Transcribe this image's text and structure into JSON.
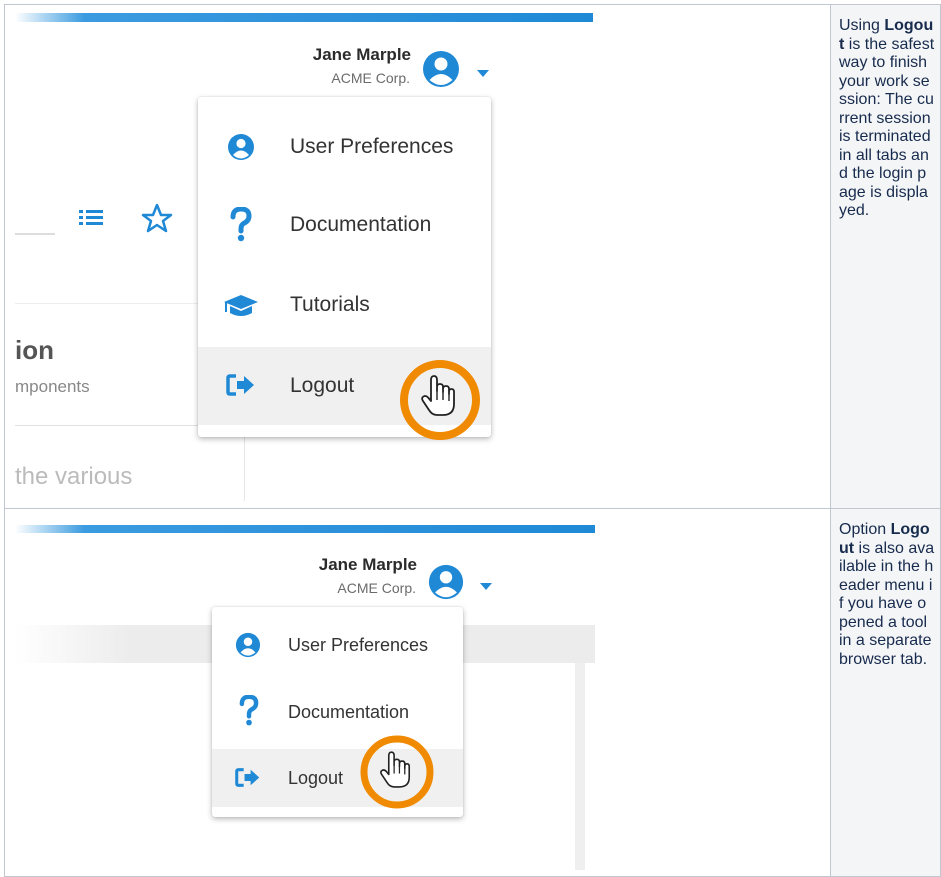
{
  "rows": [
    {
      "screenshot": {
        "user_name": "Jane Marple",
        "user_org": "ACME Corp.",
        "menu_items": [
          {
            "label": "User Preferences",
            "icon": "user-circle-icon"
          },
          {
            "label": "Documentation",
            "icon": "question-mark-icon"
          },
          {
            "label": "Tutorials",
            "icon": "graduation-cap-icon"
          },
          {
            "label": "Logout",
            "icon": "sign-out-icon"
          }
        ],
        "background_heading": "ion",
        "background_sub": "mponents",
        "background_text": "the various"
      },
      "description": {
        "pre": "Using ",
        "bold": "Logout",
        "post": " is the safest way to finish your work session: The current session is terminated in all tabs and the login page is displayed."
      }
    },
    {
      "screenshot": {
        "user_name": "Jane Marple",
        "user_org": "ACME Corp.",
        "menu_items": [
          {
            "label": "User Preferences",
            "icon": "user-circle-icon"
          },
          {
            "label": "Documentation",
            "icon": "question-mark-icon"
          },
          {
            "label": "Logout",
            "icon": "sign-out-icon"
          }
        ]
      },
      "description": {
        "pre": "Option ",
        "bold": "Logout",
        "post": " is also available in the header menu if you have opened a tool in a separate browser tab."
      }
    }
  ],
  "colors": {
    "accent_blue": "#1f89d6",
    "highlight_orange": "#f08a00",
    "cell_background": "#f4f5f7"
  }
}
